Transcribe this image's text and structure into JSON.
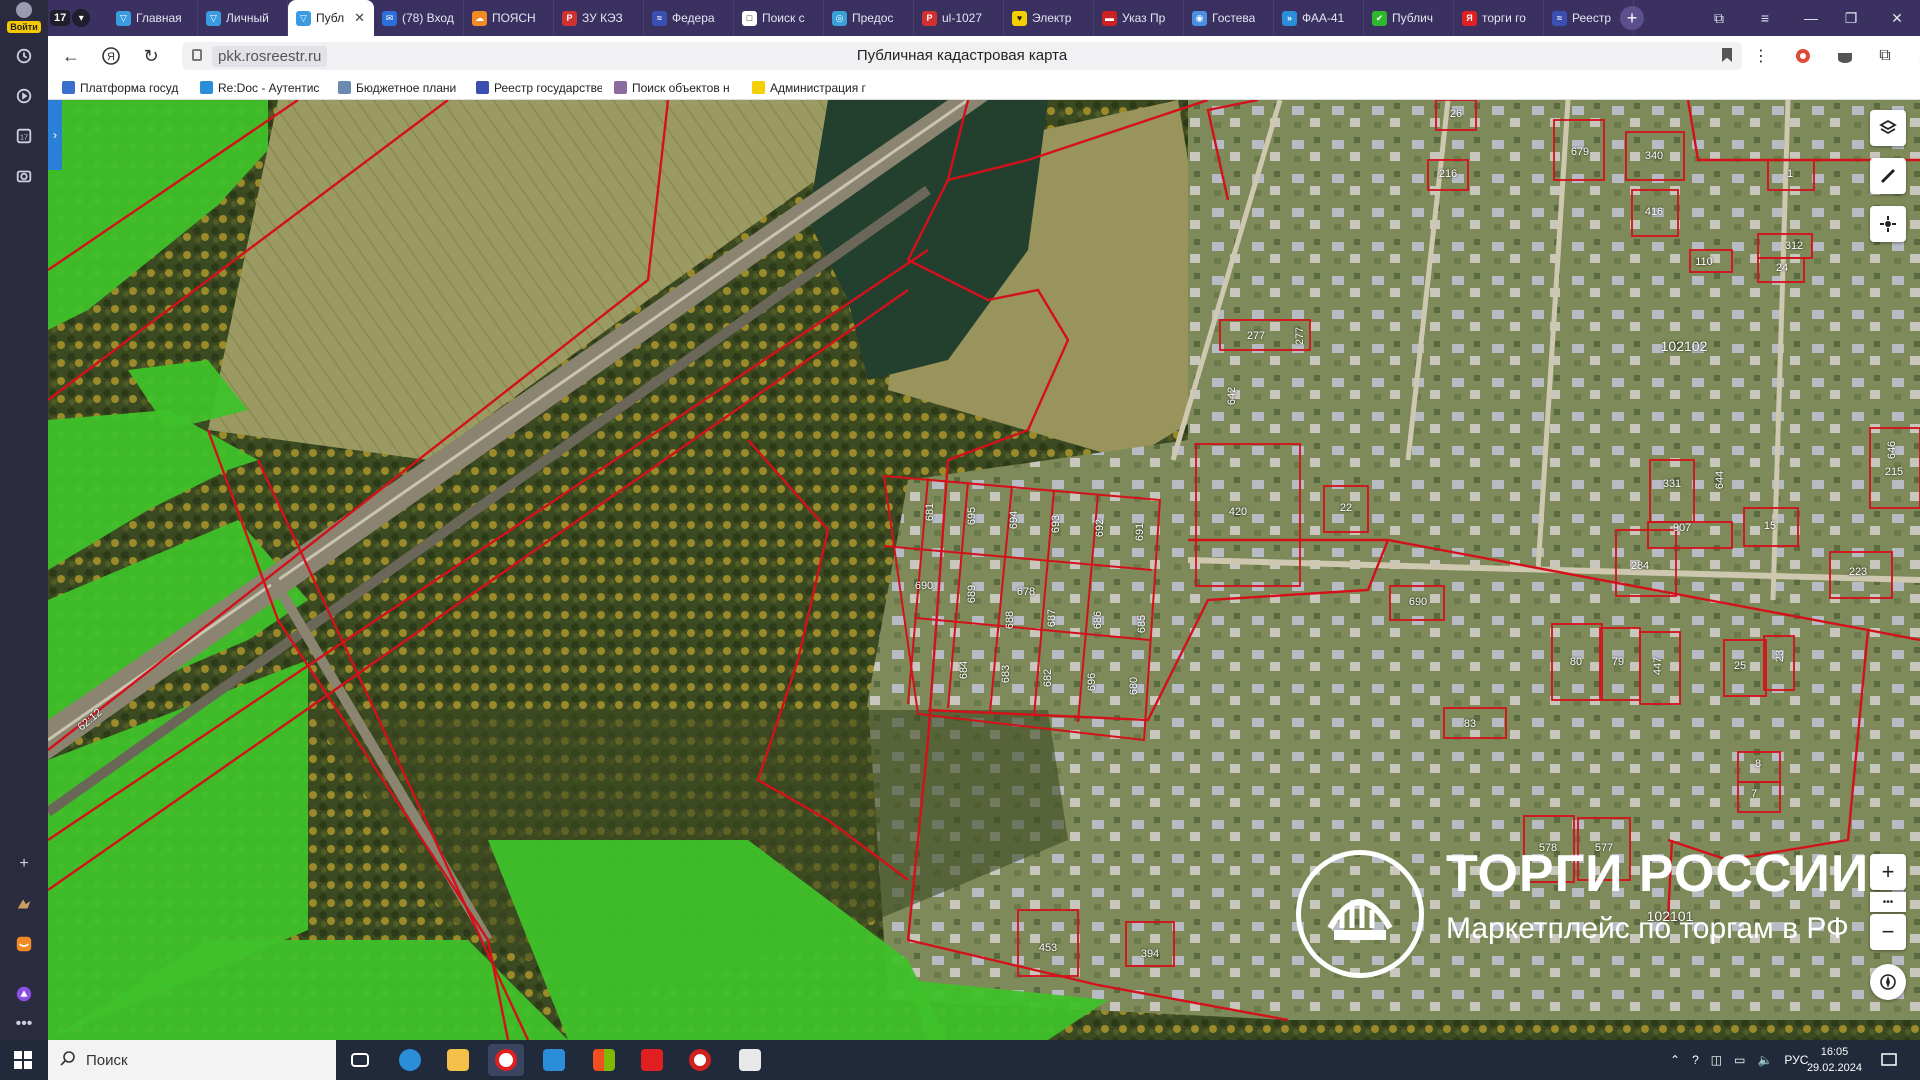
{
  "sidebar": {
    "login_label": "Войти",
    "tab_count": "17"
  },
  "tabstrip": {
    "tab_count": "17",
    "tabs": [
      {
        "label": "Главная",
        "color": "#3a9be0",
        "glyph": "▽"
      },
      {
        "label": "Личный",
        "color": "#3a9be0",
        "glyph": "▽"
      },
      {
        "label": "Публ",
        "color": "#3a9be0",
        "glyph": "▽",
        "active": true
      },
      {
        "label": "(78) Вход",
        "color": "#2a6fdb",
        "glyph": "✉"
      },
      {
        "label": "ПОЯСН",
        "color": "#f08a24",
        "glyph": "☁"
      },
      {
        "label": "ЗУ КЭЗ",
        "color": "#d03030",
        "glyph": "P"
      },
      {
        "label": "Федера",
        "color": "#3a4fb0",
        "glyph": "≈"
      },
      {
        "label": "Поиск с",
        "color": "#ffffff",
        "glyph": "□"
      },
      {
        "label": "Предос",
        "color": "#3aa0d8",
        "glyph": "◎"
      },
      {
        "label": "ul-1027",
        "color": "#d03030",
        "glyph": "P"
      },
      {
        "label": "Электр",
        "color": "#f5d000",
        "glyph": "♥"
      },
      {
        "label": "Указ Пр",
        "color": "#cc2222",
        "glyph": "▬"
      },
      {
        "label": "Гостева",
        "color": "#4a90e2",
        "glyph": "◉"
      },
      {
        "label": "ФАА-41",
        "color": "#2a8fd8",
        "glyph": "»"
      },
      {
        "label": "Публич",
        "color": "#2eb82e",
        "glyph": "✔"
      },
      {
        "label": "торги го",
        "color": "#e02020",
        "glyph": "Я"
      },
      {
        "label": "Реестр",
        "color": "#3a4fb0",
        "glyph": "≈"
      }
    ]
  },
  "navbar": {
    "url": "pkk.rosreestr.ru",
    "page_title": "Публичная кадастровая карта"
  },
  "bookmarks": [
    {
      "label": "Платформа госуд",
      "color": "#3a6fd0"
    },
    {
      "label": "Re:Doc - Аутентис",
      "color": "#2a8fd8"
    },
    {
      "label": "Бюджетное плани",
      "color": "#6a8ab0"
    },
    {
      "label": "Реестр государстве",
      "color": "#3a4fb0"
    },
    {
      "label": "Поиск объектов н",
      "color": "#8a6aa0"
    },
    {
      "label": "Администрация г",
      "color": "#f5d000"
    }
  ],
  "map": {
    "parcel_labels": [
      "26",
      "216",
      "679",
      "340",
      "416",
      "1",
      "312",
      "24",
      "110",
      "277",
      "277",
      "642",
      "102102",
      "420",
      "22",
      "331",
      "907",
      "15",
      "215",
      "646",
      "644",
      "223",
      "284",
      "690",
      "80",
      "79",
      "447",
      "25",
      "23",
      "83",
      "8",
      "7",
      "578",
      "577",
      "102101",
      "453",
      "394",
      "681",
      "695",
      "694",
      "693",
      "692",
      "691",
      "690",
      "689",
      "678",
      "688",
      "687",
      "686",
      "685",
      "684",
      "683",
      "682",
      "696",
      "680",
      "62:12"
    ],
    "controls": {
      "zoom_in": "+",
      "zoom_out": "−",
      "more": "•••"
    }
  },
  "watermark": {
    "title": "ТОРГИ РОССИИ",
    "subtitle": "Маркетплейс по торгам в РФ"
  },
  "taskbar": {
    "search_placeholder": "Поиск",
    "lang": "РУС",
    "time": "16:05",
    "date": "29.02.2024"
  }
}
